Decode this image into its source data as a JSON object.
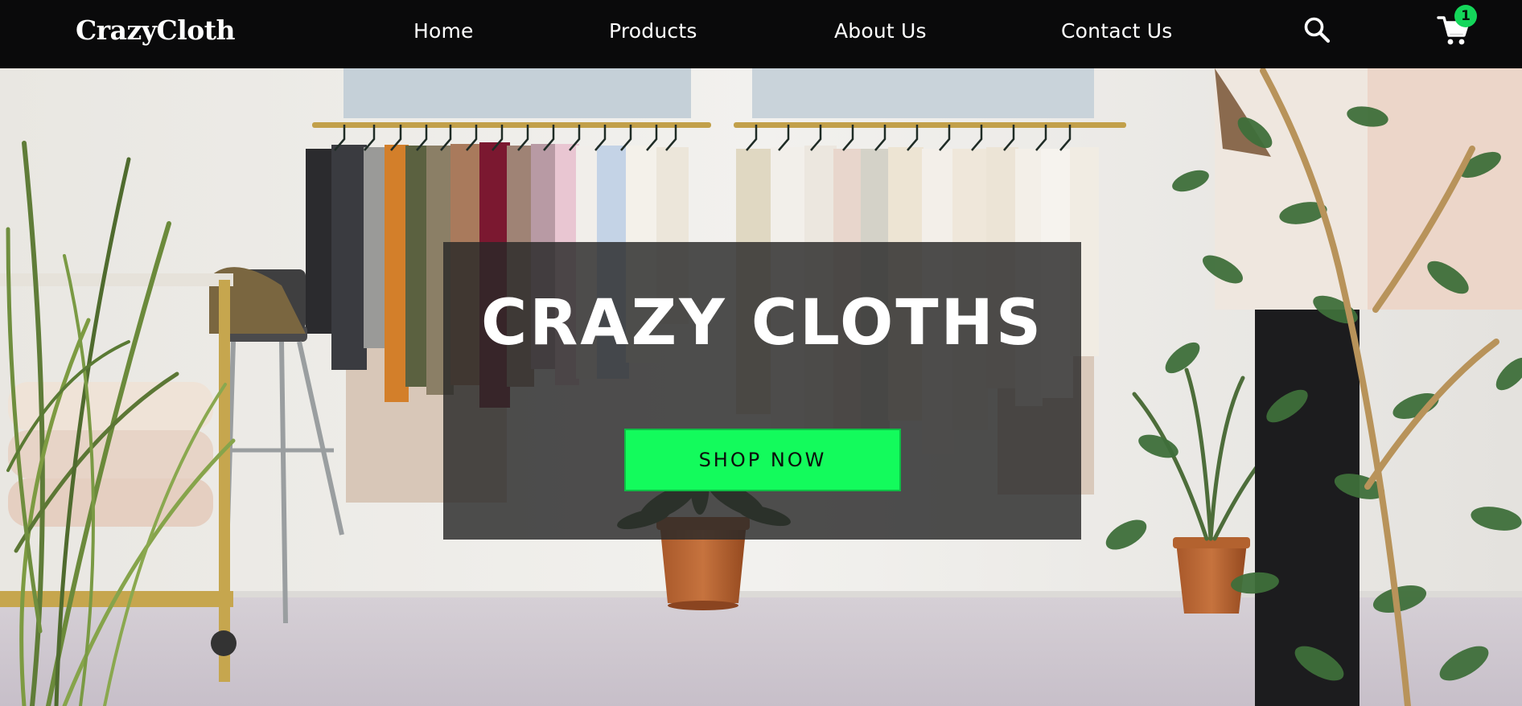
{
  "navbar": {
    "logo": "CrazyCloth",
    "links": [
      {
        "label": "Home"
      },
      {
        "label": "Products"
      },
      {
        "label": "About Us"
      },
      {
        "label": "Contact Us"
      }
    ],
    "search_icon": "search-icon",
    "cart_icon": "cart-icon",
    "cart_count": "1"
  },
  "hero": {
    "title": "CRAZY CLOTHS",
    "cta_label": "SHOP NOW",
    "image": "clothing-store-interior-with-racks-and-plants"
  },
  "colors": {
    "navbar_bg": "#0a0a0b",
    "accent_green": "#13fb5c",
    "badge_green": "#14d65a",
    "overlay": "rgba(40,40,40,0.82)"
  }
}
